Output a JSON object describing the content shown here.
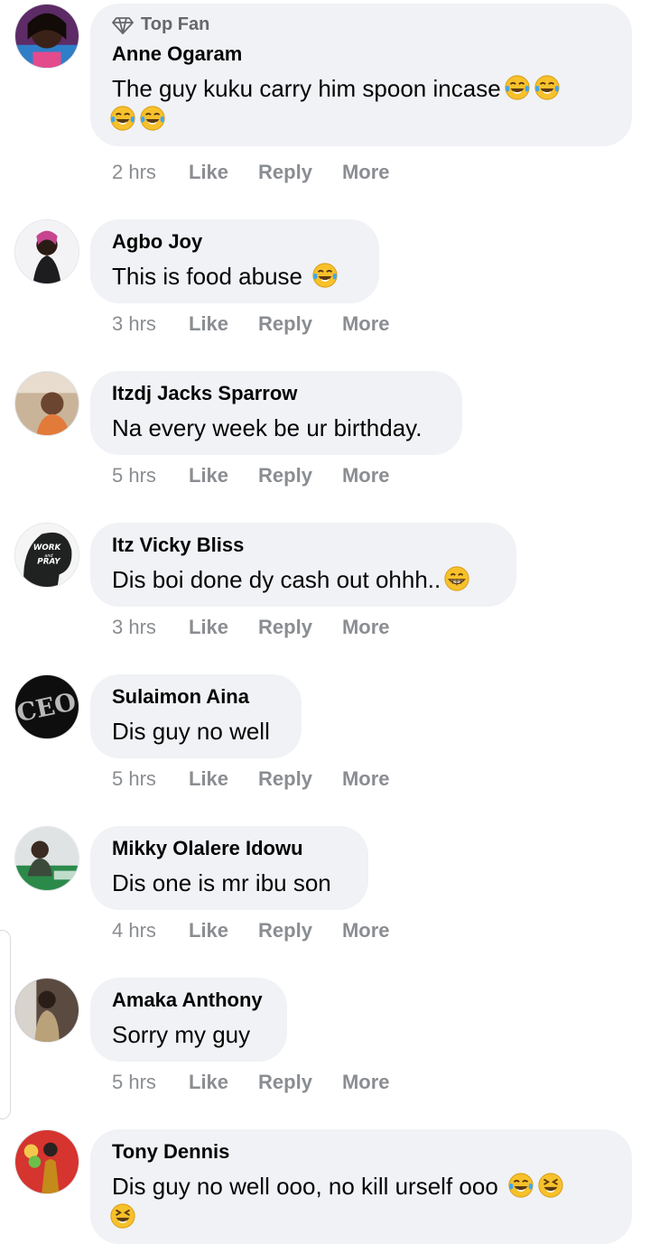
{
  "comments": [
    {
      "author": "Anne Ogaram",
      "badge": "Top Fan",
      "text_line1": "The guy kuku carry him spoon incase",
      "time": "2 hrs",
      "emoji": [
        "laughing-tears",
        "laughing-tears",
        "laughing-tears",
        "laughing-tears"
      ]
    },
    {
      "author": "Agbo Joy",
      "text": "This is food abuse ",
      "time": "3 hrs",
      "emoji": [
        "laughing-tears"
      ]
    },
    {
      "author": "Itzdj Jacks Sparrow",
      "text": "Na every week be ur birthday.",
      "time": "5 hrs"
    },
    {
      "author": "Itz Vicky Bliss",
      "text": "Dis boi done dy cash out ohhh..",
      "time": "3 hrs",
      "emoji": [
        "grinning"
      ]
    },
    {
      "author": "Sulaimon Aina",
      "text": "Dis guy no well",
      "time": "5 hrs"
    },
    {
      "author": "Mikky Olalere Idowu",
      "text": "Dis one is mr ibu son",
      "time": "4 hrs"
    },
    {
      "author": "Amaka Anthony",
      "text": "Sorry my guy",
      "time": "5 hrs"
    },
    {
      "author": "Tony Dennis",
      "text": "Dis guy no well ooo, no kill urself ooo ",
      "emoji": [
        "laughing-tears",
        "squinting-laugh",
        "squinting-laugh"
      ]
    }
  ],
  "actions": {
    "like": "Like",
    "reply": "Reply",
    "more": "More"
  },
  "avatar_text": {
    "c4_line1": "WORK",
    "c4_line2": "and",
    "c4_line3": "PRAY",
    "c5": "CEO"
  },
  "colors": {
    "bubble": "#f0f2f5",
    "meta": "#8a8d91",
    "badge": "#65676b",
    "text": "#050505",
    "emoji_face": "#f7c12b",
    "emoji_tear": "#3ea7f2"
  }
}
